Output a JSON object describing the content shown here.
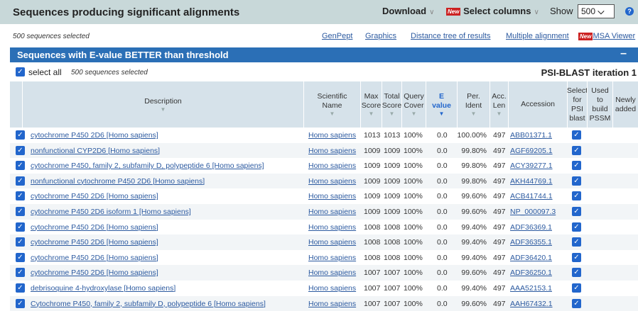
{
  "header": {
    "title": "Sequences producing significant alignments",
    "download": "Download",
    "new_badge": "New",
    "select_columns": "Select columns",
    "show_label": "Show",
    "show_value": "500"
  },
  "toolbar": {
    "count": "500 sequences selected",
    "links": [
      "GenPept",
      "Graphics",
      "Distance tree of results",
      "Multiple alignment",
      "MSA Viewer"
    ]
  },
  "section": {
    "title": "Sequences with E-value BETTER than threshold",
    "collapse": "–"
  },
  "select_all": {
    "label": "select all",
    "count": "500 sequences selected",
    "iteration": "PSI-BLAST iteration 1"
  },
  "columns": {
    "description": "Description",
    "sci1": "Scientific",
    "sci2": "Name",
    "max1": "Max",
    "max2": "Score",
    "tot1": "Total",
    "tot2": "Score",
    "qc1": "Query",
    "qc2": "Cover",
    "e1": "E",
    "e2": "value",
    "pi1": "Per.",
    "pi2": "Ident",
    "acc1": "Acc.",
    "acc2": "Len",
    "accession": "Accession",
    "sel1": "Select",
    "sel2": "for",
    "sel3": "PSI",
    "sel4": "blast",
    "used1": "Used",
    "used2": "to",
    "used3": "build",
    "used4": "PSSM",
    "new1": "Newly",
    "new2": "added"
  },
  "rows": [
    {
      "desc": "cytochrome P450 2D6 [Homo sapiens]",
      "sci": "Homo sapiens",
      "max": "1013",
      "total": "1013",
      "cover": "100%",
      "e": "0.0",
      "ident": "100.00%",
      "len": "497",
      "acc": "ABB01371.1"
    },
    {
      "desc": "nonfunctional CYP2D6 [Homo sapiens]",
      "sci": "Homo sapiens",
      "max": "1009",
      "total": "1009",
      "cover": "100%",
      "e": "0.0",
      "ident": "99.80%",
      "len": "497",
      "acc": "AGF69205.1"
    },
    {
      "desc": "cytochrome P450, family 2, subfamily D, polypeptide 6 [Homo sapiens]",
      "sci": "Homo sapiens",
      "max": "1009",
      "total": "1009",
      "cover": "100%",
      "e": "0.0",
      "ident": "99.80%",
      "len": "497",
      "acc": "ACY39277.1"
    },
    {
      "desc": "nonfunctional cytochrome P450 2D6 [Homo sapiens]",
      "sci": "Homo sapiens",
      "max": "1009",
      "total": "1009",
      "cover": "100%",
      "e": "0.0",
      "ident": "99.80%",
      "len": "497",
      "acc": "AKH44769.1"
    },
    {
      "desc": "cytochrome P450 2D6 [Homo sapiens]",
      "sci": "Homo sapiens",
      "max": "1009",
      "total": "1009",
      "cover": "100%",
      "e": "0.0",
      "ident": "99.60%",
      "len": "497",
      "acc": "ACB41744.1"
    },
    {
      "desc": "cytochrome P450 2D6 isoform 1 [Homo sapiens]",
      "sci": "Homo sapiens",
      "max": "1009",
      "total": "1009",
      "cover": "100%",
      "e": "0.0",
      "ident": "99.60%",
      "len": "497",
      "acc": "NP_000097.3"
    },
    {
      "desc": "cytochrome P450 2D6 [Homo sapiens]",
      "sci": "Homo sapiens",
      "max": "1008",
      "total": "1008",
      "cover": "100%",
      "e": "0.0",
      "ident": "99.40%",
      "len": "497",
      "acc": "ADF36369.1"
    },
    {
      "desc": "cytochrome P450 2D6 [Homo sapiens]",
      "sci": "Homo sapiens",
      "max": "1008",
      "total": "1008",
      "cover": "100%",
      "e": "0.0",
      "ident": "99.40%",
      "len": "497",
      "acc": "ADF36355.1"
    },
    {
      "desc": "cytochrome P450 2D6 [Homo sapiens]",
      "sci": "Homo sapiens",
      "max": "1008",
      "total": "1008",
      "cover": "100%",
      "e": "0.0",
      "ident": "99.40%",
      "len": "497",
      "acc": "ADF36420.1"
    },
    {
      "desc": "cytochrome P450 2D6 [Homo sapiens]",
      "sci": "Homo sapiens",
      "max": "1007",
      "total": "1007",
      "cover": "100%",
      "e": "0.0",
      "ident": "99.60%",
      "len": "497",
      "acc": "ADF36250.1"
    },
    {
      "desc": "debrisoquine 4-hydroxylase [Homo sapiens]",
      "sci": "Homo sapiens",
      "max": "1007",
      "total": "1007",
      "cover": "100%",
      "e": "0.0",
      "ident": "99.40%",
      "len": "497",
      "acc": "AAA52153.1"
    },
    {
      "desc": "Cytochrome P450, family 2, subfamily D, polypeptide 6 [Homo sapiens]",
      "sci": "Homo sapiens",
      "max": "1007",
      "total": "1007",
      "cover": "100%",
      "e": "0.0",
      "ident": "99.60%",
      "len": "497",
      "acc": "AAH67432.1"
    }
  ]
}
